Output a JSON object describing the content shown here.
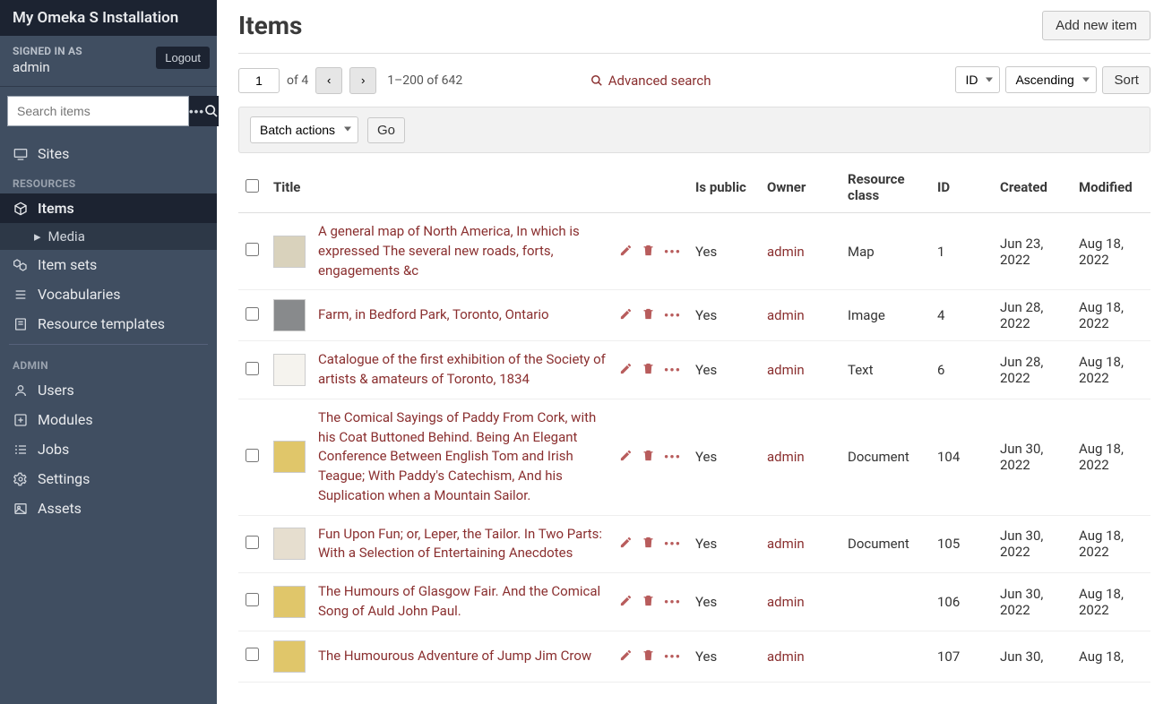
{
  "brand": "My Omeka S Installation",
  "auth": {
    "signed_label": "SIGNED IN AS",
    "user": "admin",
    "logout": "Logout"
  },
  "search": {
    "placeholder": "Search items"
  },
  "nav": {
    "sites": "Sites",
    "resources_heading": "RESOURCES",
    "items": "Items",
    "media": "Media",
    "item_sets": "Item sets",
    "vocabularies": "Vocabularies",
    "resource_templates": "Resource templates",
    "admin_heading": "ADMIN",
    "users": "Users",
    "modules": "Modules",
    "jobs": "Jobs",
    "settings": "Settings",
    "assets": "Assets"
  },
  "page": {
    "title": "Items",
    "add_btn": "Add new item"
  },
  "pager": {
    "current": "1",
    "of": "of 4",
    "range": "1–200 of 642"
  },
  "adv_search": "Advanced search",
  "sort": {
    "field": "ID",
    "dir": "Ascending",
    "btn": "Sort"
  },
  "batch": {
    "label": "Batch actions",
    "go": "Go"
  },
  "columns": {
    "title": "Title",
    "is_public": "Is public",
    "owner": "Owner",
    "rclass": "Resource class",
    "id": "ID",
    "created": "Created",
    "modified": "Modified"
  },
  "rows": [
    {
      "title": "A general map of North America, In which is expressed The several new roads, forts, engagements &c",
      "is_public": "Yes",
      "owner": "admin",
      "rclass": "Map",
      "id": "1",
      "created": "Jun 23, 2022",
      "modified": "Aug 18, 2022",
      "thumb": "#d9d2bc"
    },
    {
      "title": "Farm, in Bedford Park, Toronto, Ontario",
      "is_public": "Yes",
      "owner": "admin",
      "rclass": "Image",
      "id": "4",
      "created": "Jun 28, 2022",
      "modified": "Aug 18, 2022",
      "thumb": "#888a8c"
    },
    {
      "title": "Catalogue of the first exhibition of the Society of artists & amateurs of Toronto, 1834",
      "is_public": "Yes",
      "owner": "admin",
      "rclass": "Text",
      "id": "6",
      "created": "Jun 28, 2022",
      "modified": "Aug 18, 2022",
      "thumb": "#f5f3ee"
    },
    {
      "title": "The Comical Sayings of Paddy From Cork, with his Coat Buttoned Behind. Being An Elegant Conference Between English Tom and Irish Teague; With Paddy's Catechism, And his Suplication when a Mountain Sailor.",
      "is_public": "Yes",
      "owner": "admin",
      "rclass": "Document",
      "id": "104",
      "created": "Jun 30, 2022",
      "modified": "Aug 18, 2022",
      "thumb": "#e0c66a"
    },
    {
      "title": "Fun Upon Fun; or, Leper, the Tailor. In Two Parts: With a Selection of Entertaining Anecdotes",
      "is_public": "Yes",
      "owner": "admin",
      "rclass": "Document",
      "id": "105",
      "created": "Jun 30, 2022",
      "modified": "Aug 18, 2022",
      "thumb": "#e6decf"
    },
    {
      "title": "The Humours of Glasgow Fair. And the Comical Song of Auld John Paul.",
      "is_public": "Yes",
      "owner": "admin",
      "rclass": "",
      "id": "106",
      "created": "Jun 30, 2022",
      "modified": "Aug 18, 2022",
      "thumb": "#e0c66a"
    },
    {
      "title": "The Humourous Adventure of Jump Jim Crow",
      "is_public": "Yes",
      "owner": "admin",
      "rclass": "",
      "id": "107",
      "created": "Jun 30,",
      "modified": "Aug 18,",
      "thumb": "#e0c66a"
    }
  ]
}
